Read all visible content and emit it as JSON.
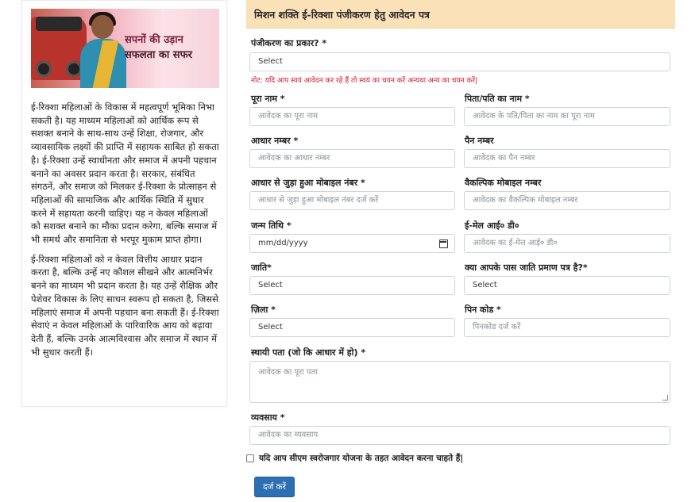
{
  "sidebar": {
    "banner_tagline": [
      "सपनों की उड़ान",
      "सफलता का सफर"
    ],
    "paragraphs": [
      "ई-रिक्शा महिलाओं के विकास में महत्वपूर्ण भूमिका निभा सकती है। यह माध्यम महिलाओं को आर्थिक रूप से सशक्त बनाने के साथ-साथ उन्हें शिक्षा, रोजगार, और व्यावसायिक लक्ष्यों की प्राप्ति में सहायक साबित हो सकता है। ई-रिक्शा उन्हें स्वाधीनता और समाज में अपनी पहचान बनाने का अवसर प्रदान करता है। सरकार, संबंधित संगठनें, और समाज को मिलकर ई-रिक्शा के प्रोत्साहन से महिलाओं की सामाजिक और आर्थिक स्थिति में सुधार करने में सहायता करनी चाहिए। यह न केवल महिलाओं को सशक्त बनाने का मौका प्रदान करेगा, बल्कि समाज में भी समर्थ और समानिता से भरपूर मुकाम प्राप्त होगा।",
      "ई-रिक्शा महिलाओं को न केवल वित्तीय आधार प्रदान करता है, बल्कि उन्हें नए कौशल सीखने और आत्मनिर्भर बनने का माध्यम भी प्रदान करता है। यह उन्हें शैक्षिक और पेशेवर विकास के लिए साधन स्वरूप हो सकता है, जिससे महिलाएं समाज में अपनी पहचान बना सकती हैं। ई-रिक्शा सेवाएं न केवल महिलाओं के पारिवारिक आय को बढ़ावा देती हैं, बल्कि उनके आत्मविश्वास और समाज में स्थान में भी सुधार करती हैं।"
    ]
  },
  "form": {
    "title": "मिशन शक्ति ई-रिक्शा पंजीकरण हेतु आवेदन पत्र",
    "registration_type": {
      "label": "पंजीकरण का प्रकार? *",
      "value": "Select"
    },
    "note": "नोट: यदि आप स्वयं आवेदन कर रहे हैं तो स्वयं का चयन करें अन्यथा अन्य का चयन करें|",
    "full_name": {
      "label": "पूरा नाम *",
      "placeholder": "आवेदक का पूरा नाम"
    },
    "father_name": {
      "label": "पिता/पति का नाम *",
      "placeholder": "आवेदक के पति/पिता का नाम का पूरा नाम"
    },
    "aadhaar": {
      "label": "आधार नम्बर *",
      "placeholder": "आवेदक का आधार नम्बर"
    },
    "pan": {
      "label": "पैन नम्बर",
      "placeholder": "आवेदक का पैन नम्बर"
    },
    "mobile": {
      "label": "आधार से जुड़ा हुआ मोबाइल नंबर *",
      "placeholder": "आधार से जुड़ा हुआ मोबाइल नंबर दर्ज करें"
    },
    "alt_mobile": {
      "label": "वैकल्पिक मोबाइल नम्बर",
      "placeholder": "आवेदक का वैकल्पिक मोबाइल नम्बर"
    },
    "dob": {
      "label": "जन्म तिथि *",
      "placeholder": "mm/dd/yyyy"
    },
    "email": {
      "label": "ई-मेल आई० डी०",
      "placeholder": "आवेदक का ई-मेल आई० डी०"
    },
    "caste": {
      "label": "जाति*",
      "value": "Select"
    },
    "caste_cert": {
      "label": "क्या आपके पास जाति प्रमाण पत्र है?*",
      "value": "Select"
    },
    "district": {
      "label": "ज़िला *",
      "value": "Select"
    },
    "pincode": {
      "label": "पिन कोड *",
      "placeholder": "पिनकोड दर्ज करें"
    },
    "address": {
      "label": "स्थायी पता (जो कि आधार में हो) *",
      "placeholder": "आवेदक का पूरा पता"
    },
    "occupation": {
      "label": "व्यवसाय *",
      "placeholder": "आवेदक का व्यवसाय"
    },
    "cm_yojana_label": "यदि आप सीएम स्वरोजगार योजना के तहत आवेदन करना चाहते हैं|",
    "submit_label": "दर्ज करें"
  },
  "colors": {
    "header_bg": "#fbe1b8",
    "note_red": "#d1172f",
    "submit_blue": "#2d6fb3"
  }
}
